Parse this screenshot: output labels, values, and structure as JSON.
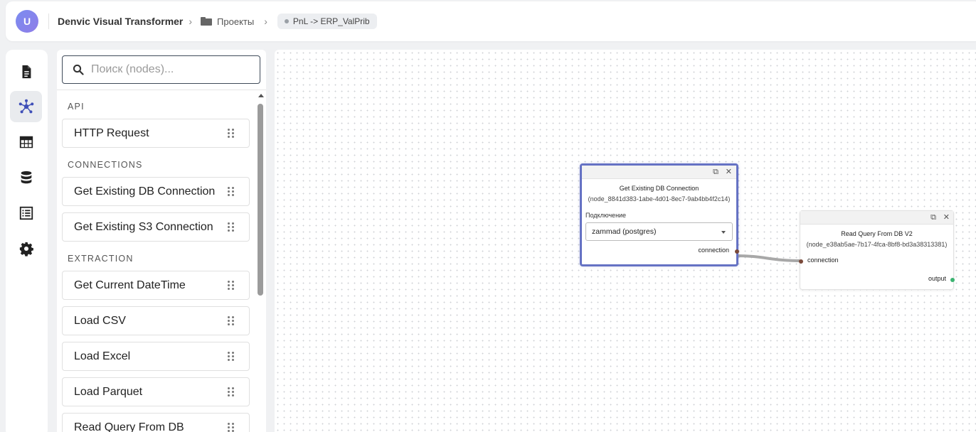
{
  "header": {
    "avatar_letter": "U",
    "app_title": "Denvic Visual Transformer",
    "breadcrumb_projects": "Проекты",
    "breadcrumb_current": "PnL -> ERP_ValPrib"
  },
  "rail": {
    "items": [
      "document-icon",
      "network-icon",
      "table-icon",
      "database-icon",
      "list-icon",
      "gear-icon"
    ],
    "active": "network-icon"
  },
  "panel": {
    "search_placeholder": "Поиск (nodes)...",
    "sections": [
      {
        "title": "API",
        "items": [
          "HTTP Request"
        ]
      },
      {
        "title": "CONNECTIONS",
        "items": [
          "Get Existing DB Connection",
          "Get Existing S3 Connection"
        ]
      },
      {
        "title": "EXTRACTION",
        "items": [
          "Get Current DateTime",
          "Load CSV",
          "Load Excel",
          "Load Parquet",
          "Read Query From DB"
        ]
      }
    ]
  },
  "canvas": {
    "node1": {
      "title": "Get Existing DB Connection",
      "id": "(node_8841d383-1abe-4d01-8ec7-9ab4bb4f2c14)",
      "field_label": "Подключение",
      "select_value": "zammad (postgres)",
      "output_port": "connection"
    },
    "node2": {
      "title": "Read Query From DB V2",
      "id": "(node_e38ab5ae-7b17-4fca-8bf8-bd3a38313381)",
      "input_port": "connection",
      "output_port": "output"
    },
    "colors": {
      "selected_border": "#6572c4",
      "port_connection": "#7a4a3a",
      "port_output": "#3cb371",
      "edge": "#a8a8a8"
    }
  }
}
